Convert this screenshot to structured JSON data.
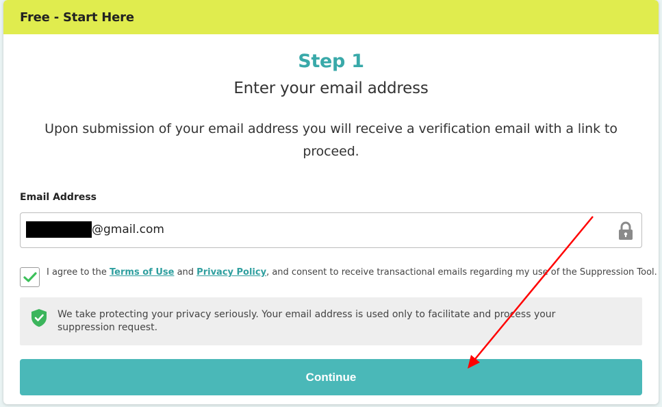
{
  "header": {
    "title": "Free - Start Here"
  },
  "step": {
    "title": "Step 1",
    "subtitle": "Enter your email address",
    "description": "Upon submission of your email address you will receive a verification email with a link to proceed."
  },
  "email_field": {
    "label": "Email Address",
    "value_visible": "@gmail.com"
  },
  "agreement": {
    "checked": true,
    "prefix": "I agree to the ",
    "terms_label": "Terms of Use",
    "middle": " and ",
    "privacy_label": "Privacy Policy",
    "suffix": ", and consent to receive transactional emails regarding my use of the Suppression Tool."
  },
  "privacy_notice": {
    "text": "We take protecting your privacy seriously. Your email address is used only to facilitate and process your suppression request."
  },
  "continue_button": {
    "label": "Continue"
  },
  "colors": {
    "header_bg": "#e0ec4e",
    "accent_teal": "#39a9a9",
    "button_bg": "#4ab8b8",
    "check_green": "#3cc05a",
    "shield_green": "#3cb55c",
    "annotation_red": "#ff0000"
  },
  "icons": {
    "lock": "lock-icon",
    "check": "checkmark-icon",
    "shield": "shield-check-icon",
    "annotation": "red-arrow-annotation"
  }
}
